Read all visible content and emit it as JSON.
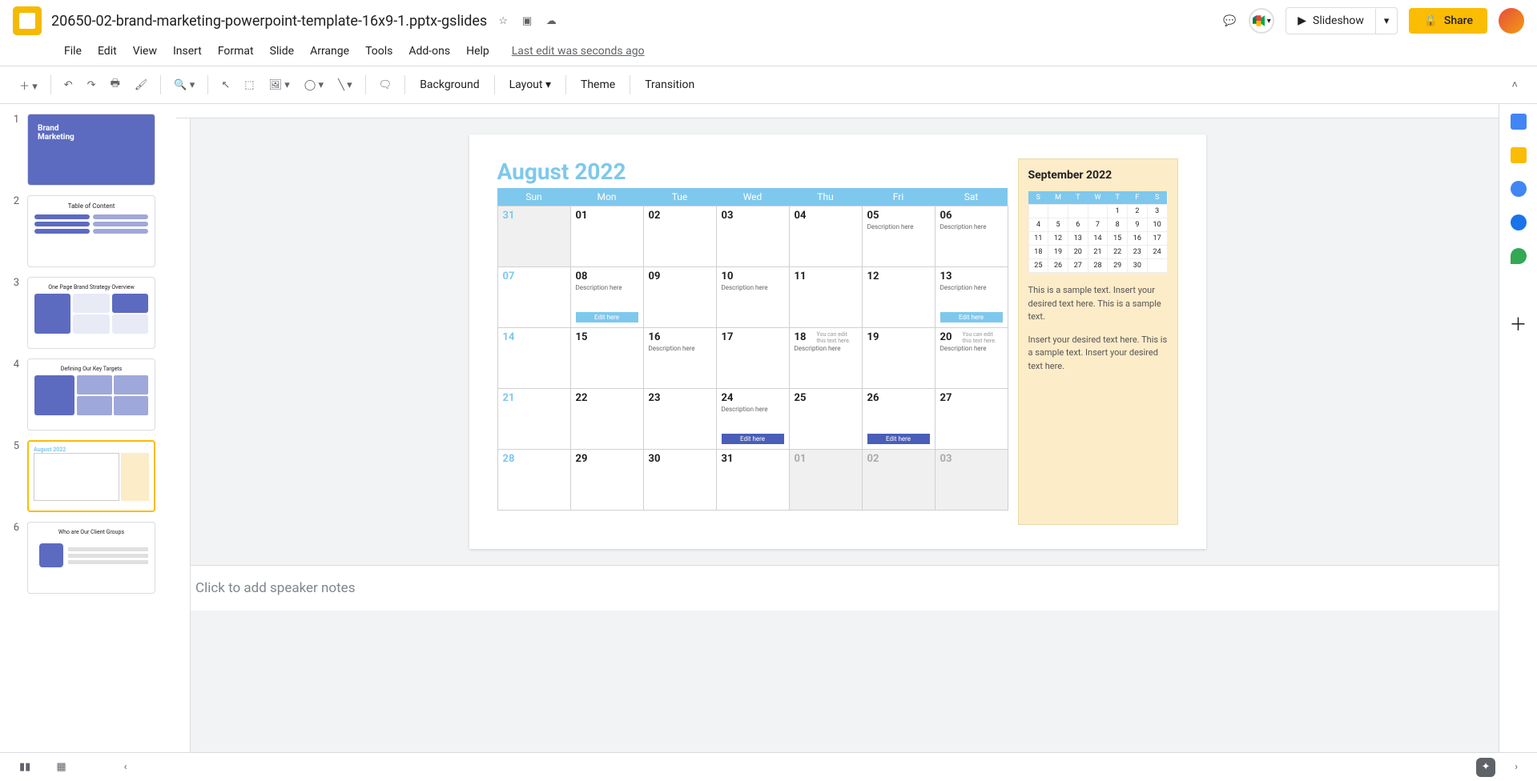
{
  "doc": {
    "title": "20650-02-brand-marketing-powerpoint-template-16x9-1.pptx-gslides"
  },
  "menu": {
    "items": [
      "File",
      "Edit",
      "View",
      "Insert",
      "Format",
      "Slide",
      "Arrange",
      "Tools",
      "Add-ons",
      "Help"
    ],
    "lastEdit": "Last edit was seconds ago"
  },
  "toolbar": {
    "background": "Background",
    "layout": "Layout",
    "theme": "Theme",
    "transition": "Transition"
  },
  "actions": {
    "slideshow": "Slideshow",
    "share": "Share"
  },
  "thumbs": {
    "s1": "Brand\nMarketing",
    "s2": "Table of Content",
    "s3": "One Page Brand Strategy Overview",
    "s4": "Defining Our Key Targets",
    "s6": "Who are Our Client Groups"
  },
  "calendar": {
    "title": "August 2022",
    "days": [
      "Sun",
      "Mon",
      "Tue",
      "Wed",
      "Thu",
      "Fri",
      "Sat"
    ],
    "weeks": [
      [
        {
          "n": "31",
          "faded": true,
          "sun": true
        },
        {
          "n": "01"
        },
        {
          "n": "02"
        },
        {
          "n": "03"
        },
        {
          "n": "04"
        },
        {
          "n": "05",
          "desc": "Description here"
        },
        {
          "n": "06",
          "desc": "Description here"
        }
      ],
      [
        {
          "n": "07",
          "sun": true
        },
        {
          "n": "08",
          "desc": "Description here",
          "tag": "Edit here",
          "tagStyle": "light"
        },
        {
          "n": "09"
        },
        {
          "n": "10",
          "desc": "Description here"
        },
        {
          "n": "11"
        },
        {
          "n": "12"
        },
        {
          "n": "13",
          "desc": "Description here",
          "tag": "Edit here",
          "tagStyle": "light"
        }
      ],
      [
        {
          "n": "14",
          "sun": true
        },
        {
          "n": "15"
        },
        {
          "n": "16",
          "desc": "Description here"
        },
        {
          "n": "17"
        },
        {
          "n": "18",
          "desc": "Description here",
          "note": "You can edit this text here."
        },
        {
          "n": "19"
        },
        {
          "n": "20",
          "desc": "Description here",
          "note": "You can edit this text here."
        }
      ],
      [
        {
          "n": "21",
          "sun": true
        },
        {
          "n": "22"
        },
        {
          "n": "23"
        },
        {
          "n": "24",
          "desc": "Description here",
          "tag": "Edit here",
          "tagStyle": "dark"
        },
        {
          "n": "25"
        },
        {
          "n": "26",
          "tag": "Edit here",
          "tagStyle": "dark"
        },
        {
          "n": "27"
        }
      ],
      [
        {
          "n": "28",
          "sun": true
        },
        {
          "n": "29"
        },
        {
          "n": "30"
        },
        {
          "n": "31"
        },
        {
          "n": "01",
          "faded": true
        },
        {
          "n": "02",
          "faded": true
        },
        {
          "n": "03",
          "faded": true
        }
      ]
    ]
  },
  "sideCal": {
    "title": "September 2022",
    "days": [
      "S",
      "M",
      "T",
      "W",
      "T",
      "F",
      "S"
    ],
    "rows": [
      [
        "",
        "",
        "",
        "",
        "1",
        "2",
        "3"
      ],
      [
        "4",
        "5",
        "6",
        "7",
        "8",
        "9",
        "10"
      ],
      [
        "11",
        "12",
        "13",
        "14",
        "15",
        "16",
        "17"
      ],
      [
        "18",
        "19",
        "20",
        "21",
        "22",
        "23",
        "24"
      ],
      [
        "25",
        "26",
        "27",
        "28",
        "29",
        "30",
        ""
      ]
    ],
    "p1": "This is a sample text. Insert your desired text here. This is a sample text.",
    "p2": "Insert your desired text here. This is a sample text. Insert your desired text here."
  },
  "notes": {
    "placeholder": "Click to add speaker notes"
  }
}
